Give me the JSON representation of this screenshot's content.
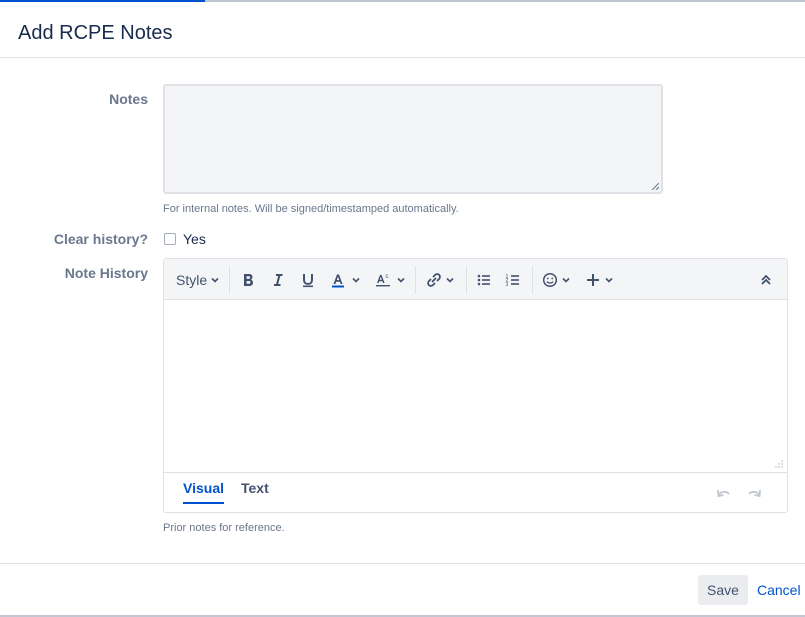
{
  "dialog": {
    "title": "Add RCPE Notes"
  },
  "notes": {
    "label": "Notes",
    "value": "",
    "help": "For internal notes. Will be signed/timestamped automatically."
  },
  "clear_history": {
    "label": "Clear history?",
    "option_label": "Yes",
    "checked": false
  },
  "note_history": {
    "label": "Note History",
    "toolbar": {
      "style_label": "Style",
      "buttons": [
        "bold-icon",
        "italic-icon",
        "underline-icon",
        "text-color-icon",
        "text-format-icon",
        "link-icon",
        "bullet-list-icon",
        "numbered-list-icon",
        "emoji-icon",
        "insert-icon",
        "collapse-icon"
      ]
    },
    "content": "",
    "tabs": [
      {
        "label": "Visual",
        "active": true
      },
      {
        "label": "Text",
        "active": false
      }
    ],
    "help": "Prior notes for reference."
  },
  "footer": {
    "save_label": "Save",
    "cancel_label": "Cancel"
  },
  "colors": {
    "accent": "#0052cc",
    "label": "#6b778c",
    "border": "#dfe1e6"
  }
}
